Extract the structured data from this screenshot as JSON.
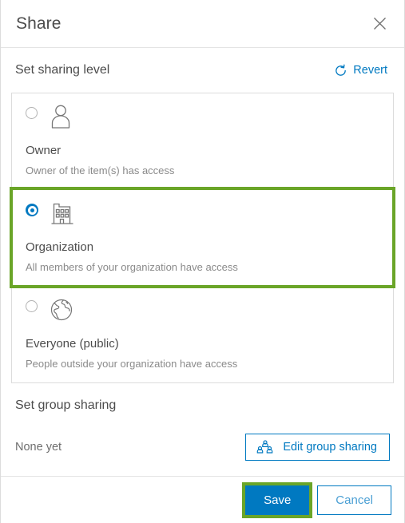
{
  "header": {
    "title": "Share",
    "close_icon": "close-icon"
  },
  "sharing_level": {
    "section_title": "Set sharing level",
    "revert_label": "Revert",
    "revert_icon": "revert-icon",
    "options": [
      {
        "id": "owner",
        "label": "Owner",
        "description": "Owner of the item(s) has access",
        "icon": "person-icon",
        "selected": false
      },
      {
        "id": "organization",
        "label": "Organization",
        "description": "All members of your organization have access",
        "icon": "building-icon",
        "selected": true
      },
      {
        "id": "everyone",
        "label": "Everyone (public)",
        "description": "People outside your organization have access",
        "icon": "globe-icon",
        "selected": false
      }
    ]
  },
  "group_sharing": {
    "section_title": "Set group sharing",
    "status_text": "None yet",
    "edit_button_label": "Edit group sharing",
    "edit_button_icon": "group-people-icon"
  },
  "footer": {
    "save_label": "Save",
    "cancel_label": "Cancel"
  },
  "colors": {
    "accent_blue": "#0079c1",
    "highlight_green": "#6aa528",
    "text_primary": "#4c4c4c",
    "text_muted": "#8a8a8a",
    "border": "#dcdcdc"
  }
}
